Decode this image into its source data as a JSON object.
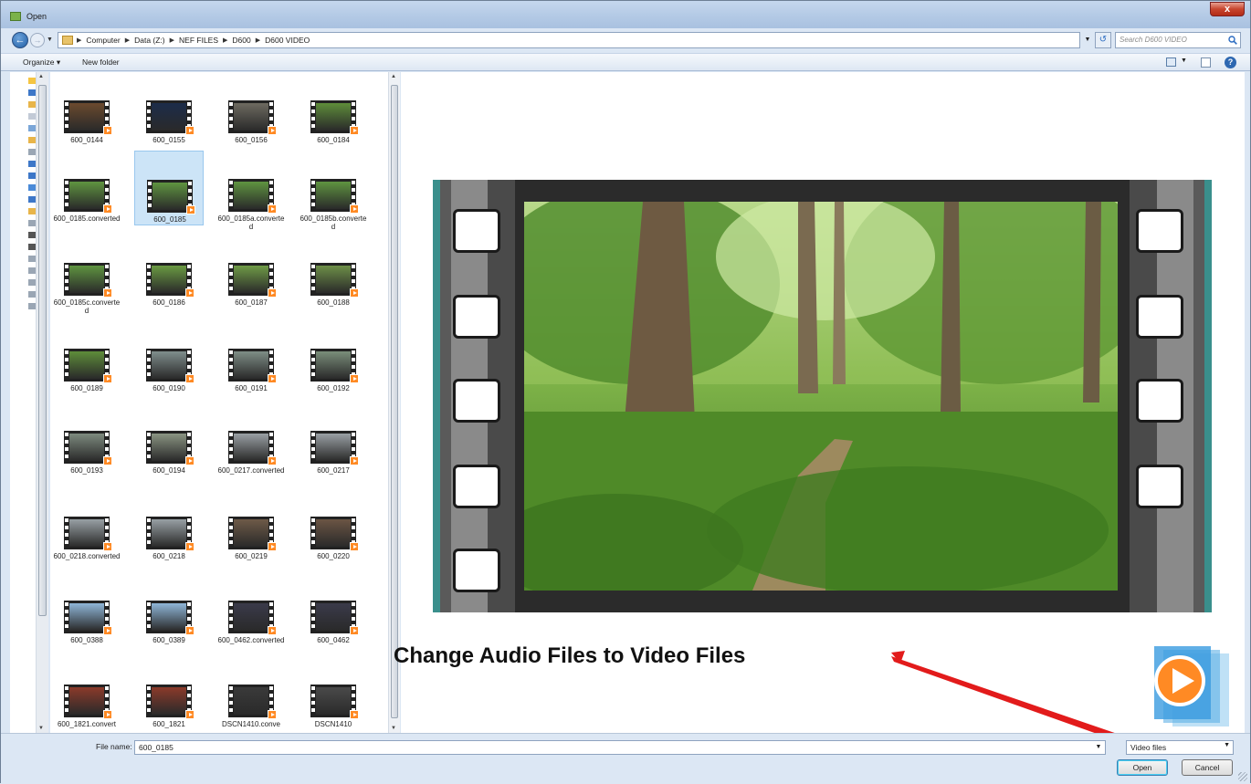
{
  "window": {
    "title": "Open",
    "close_label": "x"
  },
  "address": {
    "crumbs": [
      "Computer",
      "Data (Z:)",
      "NEF FILES",
      "D600",
      "D600 VIDEO"
    ],
    "search_placeholder": "Search D600 VIDEO"
  },
  "toolbar": {
    "organize_label": "Organize ▾",
    "new_folder_label": "New folder"
  },
  "files": [
    {
      "name": "600_0144",
      "tone": "#6b4a2e"
    },
    {
      "name": "600_0155",
      "tone": "#1c2c4a"
    },
    {
      "name": "600_0156",
      "tone": "#6d6a60"
    },
    {
      "name": "600_0184",
      "tone": "#5e8d3a"
    },
    {
      "name": "600_0185.converted",
      "tone": "#5f9440"
    },
    {
      "name": "600_0185",
      "tone": "#5f9440"
    },
    {
      "name": "600_0185a.converted",
      "tone": "#5f9440"
    },
    {
      "name": "600_0185b.converted",
      "tone": "#5f9440"
    },
    {
      "name": "600_0185c.converted",
      "tone": "#5f9440"
    },
    {
      "name": "600_0186",
      "tone": "#6a9a42"
    },
    {
      "name": "600_0187",
      "tone": "#6f9b46"
    },
    {
      "name": "600_0188",
      "tone": "#6d8f48"
    },
    {
      "name": "600_0189",
      "tone": "#5e8d3a"
    },
    {
      "name": "600_0190",
      "tone": "#7f8e8c"
    },
    {
      "name": "600_0191",
      "tone": "#7e8e86"
    },
    {
      "name": "600_0192",
      "tone": "#7a8e7a"
    },
    {
      "name": "600_0193",
      "tone": "#7d8a7e"
    },
    {
      "name": "600_0194",
      "tone": "#8a9482"
    },
    {
      "name": "600_0217.converted",
      "tone": "#9aa0a4"
    },
    {
      "name": "600_0217",
      "tone": "#9aa0a4"
    },
    {
      "name": "600_0218.converted",
      "tone": "#98a0a4"
    },
    {
      "name": "600_0218",
      "tone": "#98a0a4"
    },
    {
      "name": "600_0219",
      "tone": "#6e5a48"
    },
    {
      "name": "600_0220",
      "tone": "#6b5544"
    },
    {
      "name": "600_0388",
      "tone": "#8fb6d8"
    },
    {
      "name": "600_0389",
      "tone": "#8fb6d8"
    },
    {
      "name": "600_0462.converted",
      "tone": "#3a3a4a"
    },
    {
      "name": "600_0462",
      "tone": "#3a3a4a"
    },
    {
      "name": "600_1821.convert",
      "tone": "#8b3a2a"
    },
    {
      "name": "600_1821",
      "tone": "#8b3a2a"
    },
    {
      "name": "DSCN1410.conve",
      "tone": "#3a3a3a"
    },
    {
      "name": "DSCN1410",
      "tone": "#4a4a4a"
    }
  ],
  "selected_file": "600_0185",
  "annotation": "Change Audio Files to Video Files",
  "bottom": {
    "file_name_label": "File name:",
    "file_name_value": "600_0185",
    "file_type": "Video files",
    "open_label": "Open",
    "cancel_label": "Cancel"
  },
  "colors": {
    "accent": "#2d67b1",
    "selection": "#cce4f7",
    "arrow": "#e21b1b",
    "play": "#ff8a24"
  }
}
